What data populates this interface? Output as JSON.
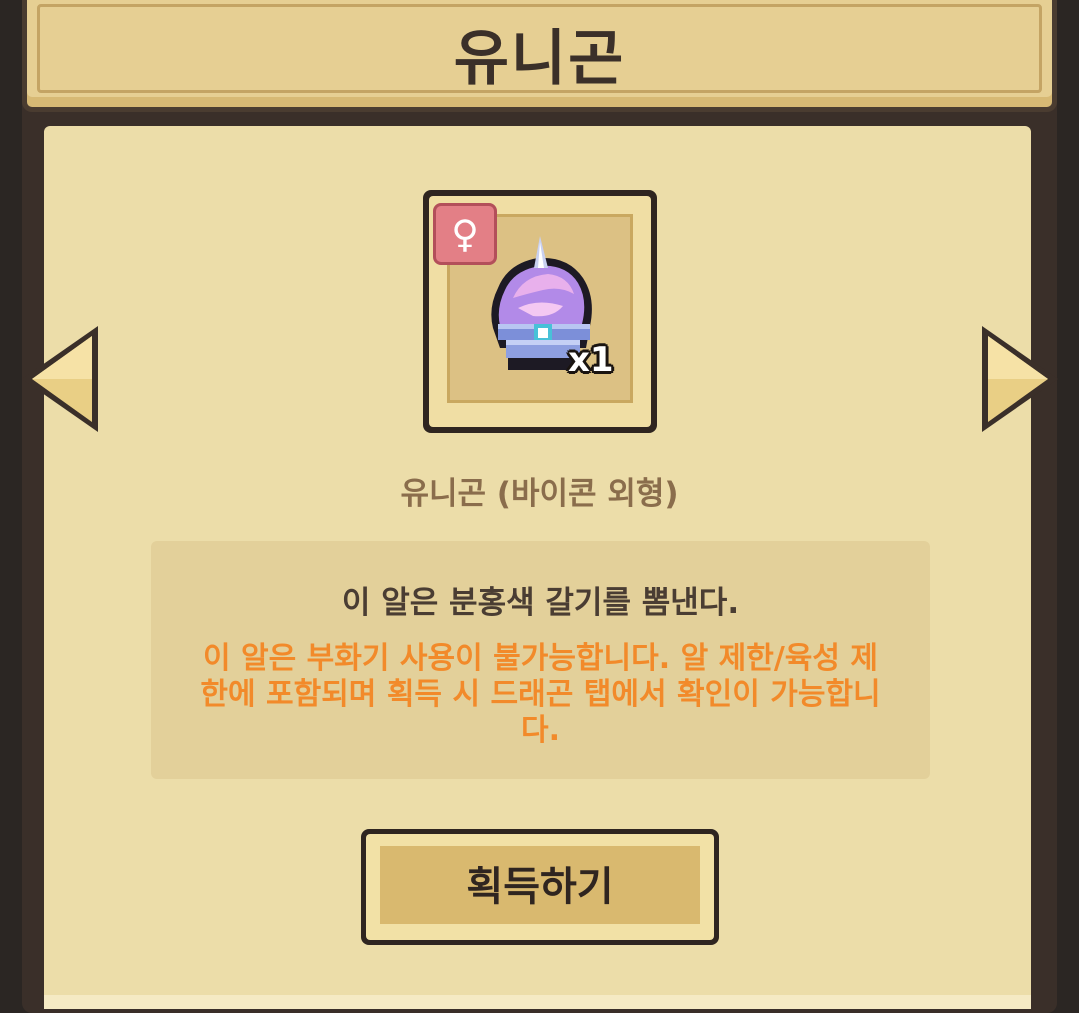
{
  "header": {
    "title": "유니곤"
  },
  "item": {
    "gender_symbol": "♀",
    "gender_icon": "female-icon",
    "quantity": "x1",
    "name": "유니곤 (바이콘 외형)"
  },
  "description": {
    "main": "이 알은 분홍색 갈기를 뽐낸다.",
    "note": "이 알은 부화기 사용이 불가능합니다. 알 제한/육성 제한에 포함되며 획득 시 드래곤 탭에서 확인이 가능합니다."
  },
  "buttons": {
    "obtain": "획득하기",
    "prev_icon": "left-arrow-icon",
    "next_icon": "right-arrow-icon"
  },
  "colors": {
    "paper": "#ecdda9",
    "frame": "#3a2f29",
    "accent_note": "#f28a2a",
    "badge": "#e37f86"
  }
}
